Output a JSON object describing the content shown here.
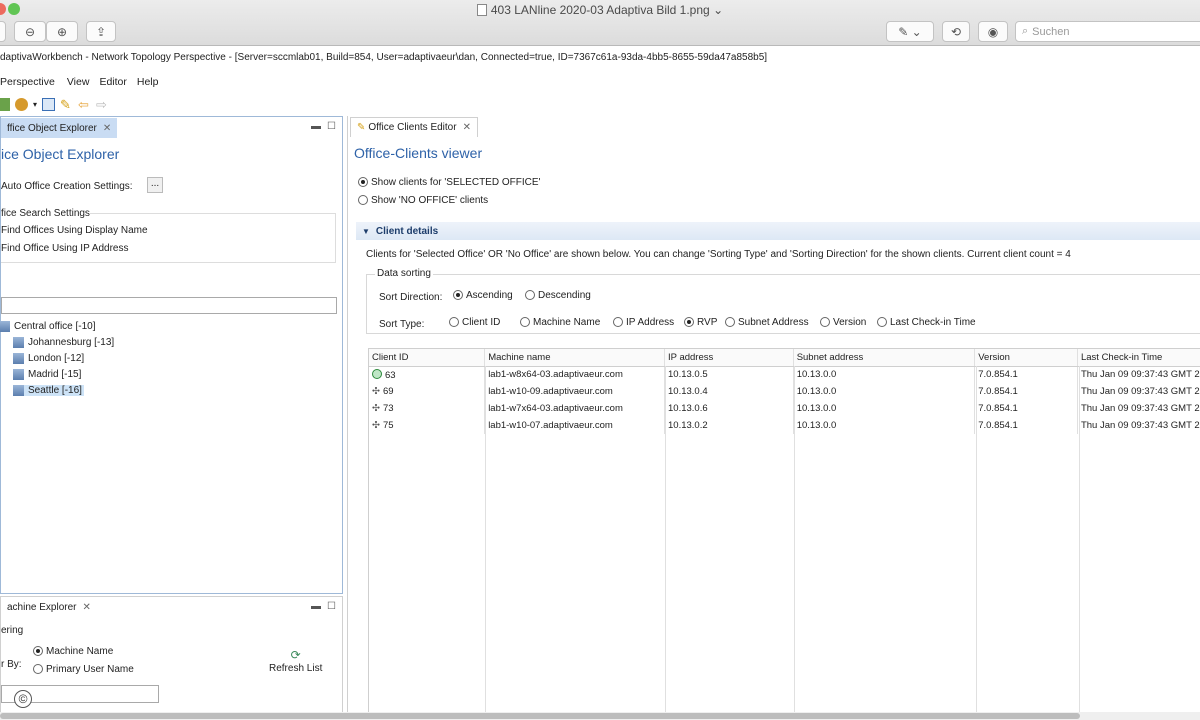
{
  "mac": {
    "title": "403 LANline 2020-03 Adaptiva Bild 1.png",
    "search_placeholder": "Suchen"
  },
  "window_title": "daptivaWorkbench - Network Topology Perspective - [Server=sccmlab01, Build=854, User=adaptivaeur\\dan, Connected=true, ID=7367c61a-93da-4bb5-8655-59da47a858b5]",
  "menu": [
    "Perspective",
    "View",
    "Editor",
    "Help"
  ],
  "left_top": {
    "tab_label": "ffice Object Explorer",
    "title": "ice Object Explorer",
    "auto_office": "Auto Office Creation Settings:",
    "dots": "...",
    "search_settings": "fice Search Settings",
    "find_display": "Find Offices Using Display Name",
    "find_ip": "Find Office Using IP Address",
    "tree": [
      {
        "label": "Central office [-10]"
      },
      {
        "label": "Johannesburg [-13]"
      },
      {
        "label": "London [-12]"
      },
      {
        "label": "Madrid [-15]"
      },
      {
        "label": "Seattle [-16]"
      }
    ]
  },
  "left_bottom": {
    "tab_label": "achine Explorer",
    "filtering": "ering",
    "filter_by": "r By:",
    "opt_machine": "Machine Name",
    "opt_primary": "Primary User Name",
    "refresh": "Refresh List"
  },
  "right": {
    "tab_label": "Office Clients Editor",
    "title": "Office-Clients viewer",
    "show_selected": "Show clients for 'SELECTED OFFICE'",
    "show_no_office": "Show 'NO OFFICE' clients",
    "section": "Client details",
    "info": "Clients for 'Selected Office' OR 'No Office' are shown below. You can change 'Sorting Type' and 'Sorting Direction' for the shown clients. Current client count = 4",
    "data_sorting": "Data sorting",
    "sort_direction": "Sort Direction:",
    "ascending": "Ascending",
    "descending": "Descending",
    "sort_type": "Sort Type:",
    "sort_types": [
      "Client ID",
      "Machine Name",
      "IP Address",
      "RVP",
      "Subnet Address",
      "Version",
      "Last Check-in Time"
    ],
    "columns": [
      "Client ID",
      "Machine name",
      "IP address",
      "Subnet address",
      "Version",
      "Last Check-in Time"
    ],
    "rows": [
      [
        "63",
        "lab1-w8x64-03.adaptivaeur.com",
        "10.13.0.5",
        "10.13.0.0",
        "7.0.854.1",
        "Thu Jan 09 09:37:43 GMT 2"
      ],
      [
        "69",
        "lab1-w10-09.adaptivaeur.com",
        "10.13.0.4",
        "10.13.0.0",
        "7.0.854.1",
        "Thu Jan 09 09:37:43 GMT 2"
      ],
      [
        "73",
        "lab1-w7x64-03.adaptivaeur.com",
        "10.13.0.6",
        "10.13.0.0",
        "7.0.854.1",
        "Thu Jan 09 09:37:43 GMT 2"
      ],
      [
        "75",
        "lab1-w10-07.adaptivaeur.com",
        "10.13.0.2",
        "10.13.0.0",
        "7.0.854.1",
        "Thu Jan 09 09:37:43 GMT 2"
      ]
    ]
  },
  "copyright_symbol": "©"
}
